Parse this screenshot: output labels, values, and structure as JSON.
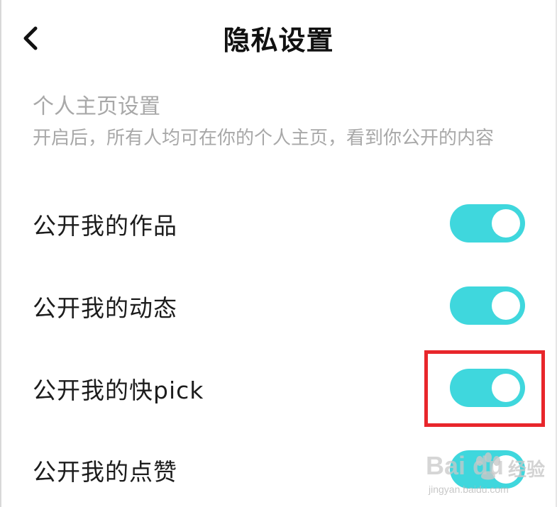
{
  "header": {
    "title": "隐私设置",
    "back_icon": "chevron-left-icon"
  },
  "section": {
    "title": "个人主页设置",
    "description": "开启后，所有人均可在你的个人主页，看到你公开的内容"
  },
  "settings": [
    {
      "label": "公开我的作品",
      "enabled": true
    },
    {
      "label": "公开我的动态",
      "enabled": true
    },
    {
      "label": "公开我的快pick",
      "enabled": true
    },
    {
      "label": "公开我的点赞",
      "enabled": true
    }
  ],
  "colors": {
    "toggle_on": "#3fd7dd",
    "highlight": "#e8262b",
    "muted_text": "#a8a8a8"
  },
  "watermark": {
    "logo": "Bai du",
    "brand": "经验",
    "url": "jingyan.baidu.com"
  }
}
